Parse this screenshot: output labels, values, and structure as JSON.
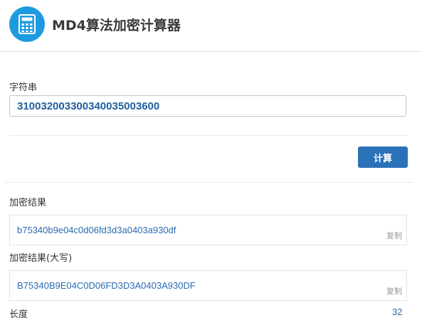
{
  "header": {
    "title": "MD4算法加密计算器",
    "icon": "calculator-icon",
    "icon_bg": "#1e9be0"
  },
  "input": {
    "label": "字符串",
    "value": "31003200330034003500360​0"
  },
  "actions": {
    "calculate_label": "计算",
    "button_color": "#2a71b8"
  },
  "results": {
    "lower": {
      "label": "加密结果",
      "value": "b75340b9e04c0d06fd3d3a0403a930df",
      "copy_label": "复制"
    },
    "upper": {
      "label": "加密结果(大写)",
      "value": "B75340B9E04C0D06FD3D3A0403A930DF",
      "copy_label": "复制"
    },
    "length": {
      "label": "长度",
      "value": "32"
    }
  }
}
